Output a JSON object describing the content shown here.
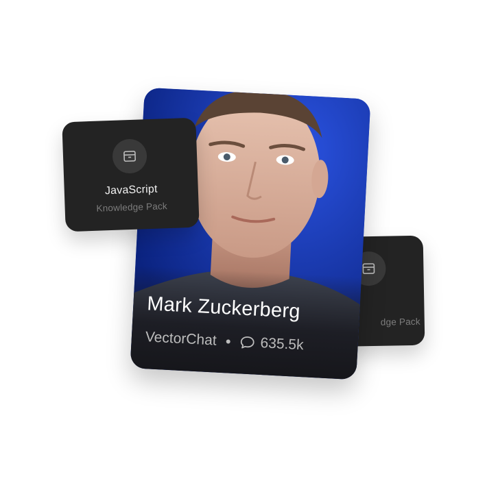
{
  "packs": [
    {
      "title": "JavaScript",
      "subtitle": "Knowledge Pack",
      "icon": "archive-box-icon"
    },
    {
      "title": "",
      "subtitle": "dge Pack",
      "icon": "archive-box-icon"
    }
  ],
  "profile": {
    "name": "Mark Zuckerberg",
    "platform": "VectorChat",
    "chat_count": "635.5k",
    "icons": {
      "chat": "chat-bubble-icon"
    }
  },
  "colors": {
    "card_dark": "#232323",
    "icon_circle": "#393939",
    "portrait_bg": "#1c3fc9",
    "muted_text": "#7d7d7d"
  }
}
